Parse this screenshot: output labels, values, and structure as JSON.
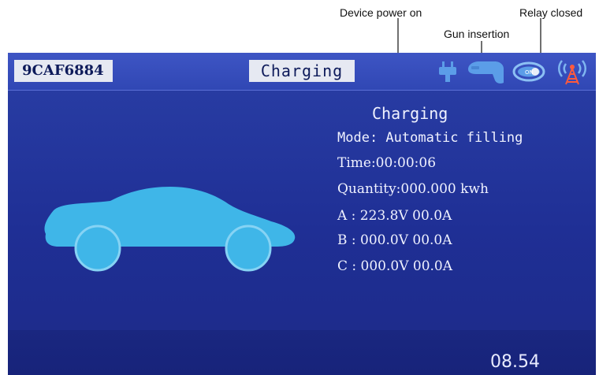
{
  "callouts": {
    "device_power": "Device power on",
    "gun_insertion": "Gun insertion",
    "relay_closed": "Relay closed"
  },
  "header": {
    "device_id": "9CAF6884",
    "status": "Charging",
    "icons": [
      "plug-icon",
      "charging-gun-icon",
      "relay-on-icon",
      "signal-tower-icon"
    ]
  },
  "info": {
    "title": "Charging",
    "mode": "Mode: Automatic filling",
    "time": "Time:00:00:06",
    "quantity": "Quantity:000.000 kwh",
    "phases": [
      "A : 223.8V 00.0A",
      "B : 000.0V 00.0A",
      "C : 000.0V 00.0A"
    ]
  },
  "footer": {
    "time": "08.54"
  },
  "colors": {
    "header": "#3047b4",
    "panel": "#1f2f95",
    "car": "#3fb6e8",
    "icon": "#5b9de8",
    "text": "#f0f2ff"
  }
}
